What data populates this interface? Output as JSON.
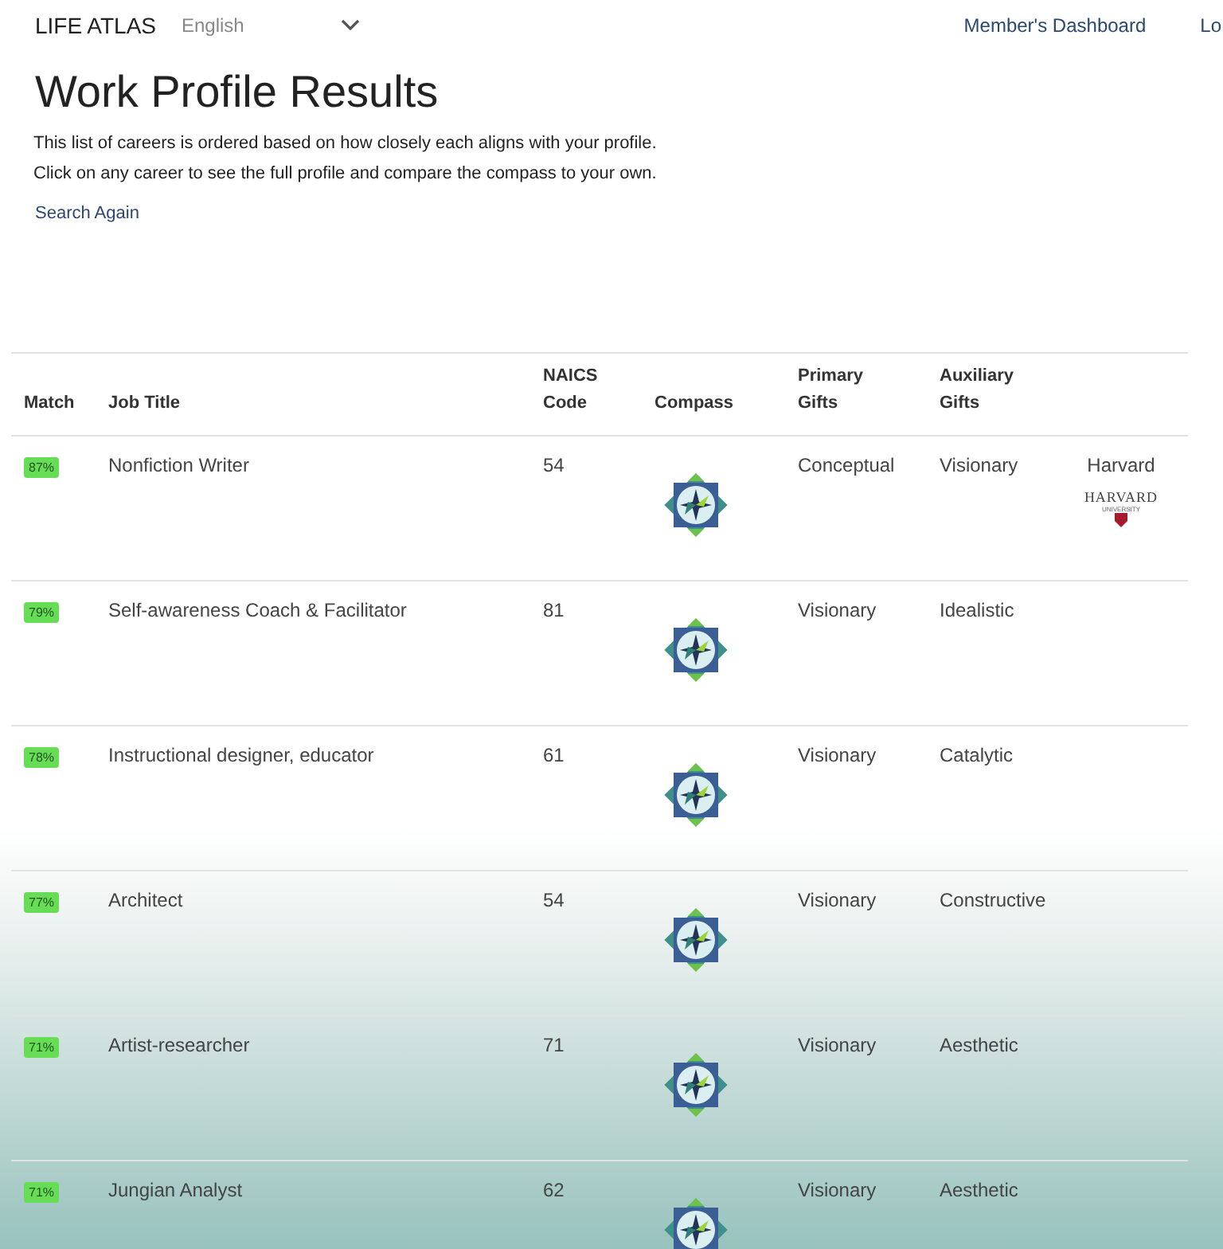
{
  "header": {
    "brand": "LIFE ATLAS",
    "language": "English",
    "links": [
      "Member's Dashboard",
      "Lo"
    ]
  },
  "title": "Work Profile Results",
  "intro": [
    "This list of careers is ordered based on how closely each aligns with your profile.",
    "Click on any career to see the full profile and compare the compass to your own."
  ],
  "search_again": "Search Again",
  "table": {
    "columns": [
      "Match",
      "Job Title",
      "NAICS Code",
      "Compass",
      "Primary Gifts",
      "Auxiliary Gifts"
    ],
    "rows": [
      {
        "match": "87%",
        "title": "Nonfiction Writer",
        "naics": "54",
        "primary": "Conceptual",
        "auxiliary": "Visionary",
        "school": "Harvard",
        "school_logo": {
          "name": "HARVARD",
          "sub": "UNIVERSITY"
        }
      },
      {
        "match": "79%",
        "title": "Self-awareness Coach & Facilitator",
        "naics": "81",
        "primary": "Visionary",
        "auxiliary": "Idealistic"
      },
      {
        "match": "78%",
        "title": "Instructional designer, educator",
        "naics": "61",
        "primary": "Visionary",
        "auxiliary": "Catalytic"
      },
      {
        "match": "77%",
        "title": "Architect",
        "naics": "54",
        "primary": "Visionary",
        "auxiliary": "Constructive"
      },
      {
        "match": "71%",
        "title": "Artist-researcher",
        "naics": "71",
        "primary": "Visionary",
        "auxiliary": "Aesthetic"
      },
      {
        "match": "71%",
        "title": "Jungian Analyst",
        "naics": "62",
        "primary": "Visionary",
        "auxiliary": "Aesthetic"
      }
    ]
  }
}
